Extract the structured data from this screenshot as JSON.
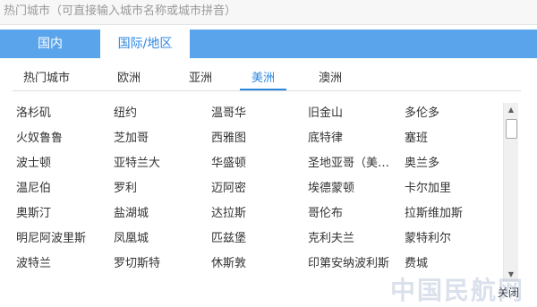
{
  "hint": "热门城市（可直接输入城市名称或城市拼音）",
  "main_tabs": [
    {
      "label": "国内",
      "active": false
    },
    {
      "label": "国际/地区",
      "active": true
    }
  ],
  "sub_tabs": [
    {
      "label": "热门城市",
      "active": false
    },
    {
      "label": "欧洲",
      "active": false
    },
    {
      "label": "亚洲",
      "active": false
    },
    {
      "label": "美洲",
      "active": true
    },
    {
      "label": "澳洲",
      "active": false
    }
  ],
  "cities": [
    [
      "洛杉矶",
      "纽约",
      "温哥华",
      "旧金山",
      "多伦多"
    ],
    [
      "火奴鲁鲁",
      "芝加哥",
      "西雅图",
      "底特律",
      "塞班"
    ],
    [
      "波士顿",
      "亚特兰大",
      "华盛顿",
      "圣地亚哥（美…",
      "奥兰多"
    ],
    [
      "温尼伯",
      "罗利",
      "迈阿密",
      "埃德蒙顿",
      "卡尔加里"
    ],
    [
      "奥斯汀",
      "盐湖城",
      "达拉斯",
      "哥伦布",
      "拉斯维加斯"
    ],
    [
      "明尼阿波里斯",
      "凤凰城",
      "匹兹堡",
      "克利夫兰",
      "蒙特利尔"
    ],
    [
      "波特兰",
      "罗切斯特",
      "休斯敦",
      "印第安纳波利斯",
      "费城"
    ]
  ],
  "close": "关闭",
  "watermark": "中国民航网"
}
